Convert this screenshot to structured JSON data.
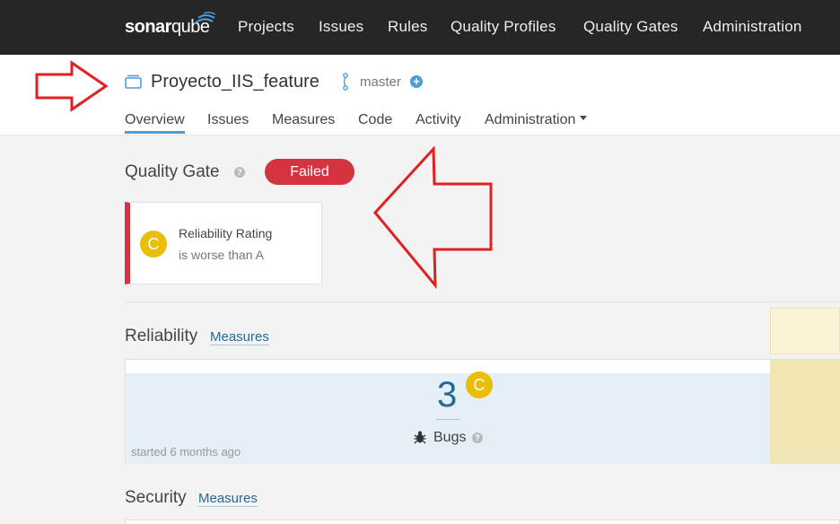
{
  "app": {
    "logo_text_bold": "sonar",
    "logo_text_light": "qube"
  },
  "topnav": {
    "items": [
      {
        "label": "Projects"
      },
      {
        "label": "Issues"
      },
      {
        "label": "Rules"
      },
      {
        "label": "Quality Profiles"
      },
      {
        "label": "Quality Gates"
      },
      {
        "label": "Administration"
      }
    ]
  },
  "project": {
    "name": "Proyecto_IIS_feature",
    "branch": "master",
    "tabs": [
      {
        "label": "Overview"
      },
      {
        "label": "Issues"
      },
      {
        "label": "Measures"
      },
      {
        "label": "Code"
      },
      {
        "label": "Activity"
      },
      {
        "label": "Administration"
      }
    ]
  },
  "quality_gate": {
    "title": "Quality Gate",
    "status": "Failed",
    "condition": {
      "rating": "C",
      "metric": "Reliability Rating",
      "detail": "is worse than A"
    }
  },
  "reliability": {
    "title": "Reliability",
    "link": "Measures",
    "bugs_value": "3",
    "bugs_rating": "C",
    "bugs_label": "Bugs",
    "started": "started 6 months ago"
  },
  "security": {
    "title": "Security",
    "link": "Measures"
  },
  "colors": {
    "nav_bg": "#262626",
    "failed": "#d4333f",
    "rating_c": "#eabe06",
    "link": "#236a97",
    "annotation_arrow": "#e02020"
  },
  "icons": {
    "help": "?",
    "add": "+"
  }
}
